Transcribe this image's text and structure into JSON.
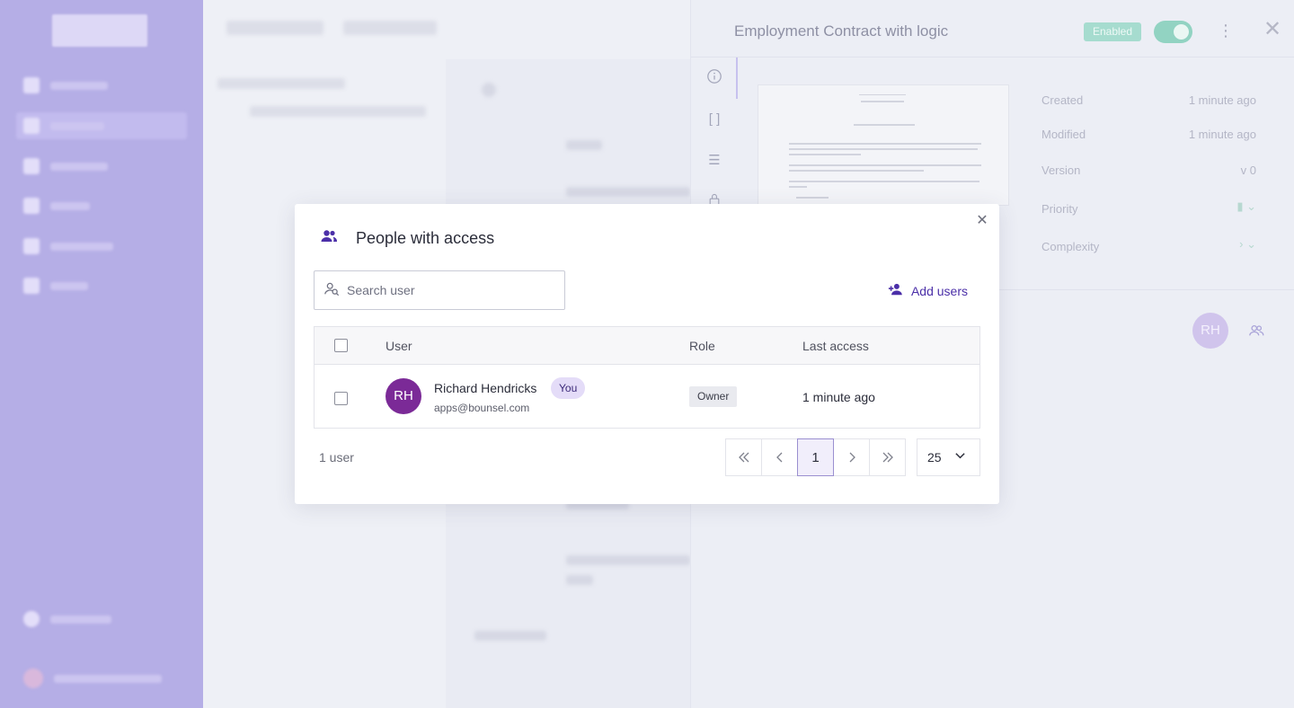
{
  "drawer": {
    "title": "Employment Contract with logic",
    "status_badge": "Enabled",
    "meta": [
      {
        "label": "Created",
        "value": "1 minute ago"
      },
      {
        "label": "Modified",
        "value": "1 minute ago"
      },
      {
        "label": "Version",
        "value": "v 0"
      },
      {
        "label": "Priority",
        "value": ""
      },
      {
        "label": "Complexity",
        "value": ""
      }
    ],
    "owner_initials": "RH"
  },
  "modal": {
    "title": "People with access",
    "search_placeholder": "Search user",
    "add_users_label": "Add users",
    "columns": {
      "user": "User",
      "role": "Role",
      "last_access": "Last access"
    },
    "rows": [
      {
        "initials": "RH",
        "name": "Richard Hendricks",
        "you_badge": "You",
        "email": "apps@bounsel.com",
        "role": "Owner",
        "last_access": "1 minute ago"
      }
    ],
    "count_label": "1 user",
    "pagination": {
      "current_page": "1",
      "per_page": "25"
    }
  },
  "colors": {
    "accent": "#4b2fa8",
    "avatar": "#7b2a97",
    "sidebar": "#b5aee6",
    "enabled": "#92d3c2"
  }
}
